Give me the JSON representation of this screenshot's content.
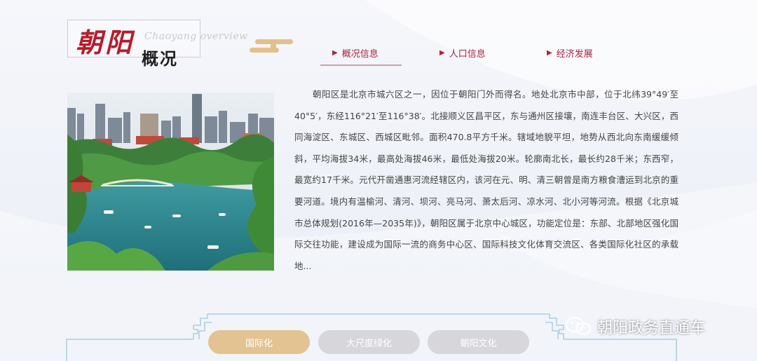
{
  "logo": {
    "title_cn": "朝阳",
    "subtitle_en": "Chaoyang overview",
    "title_cn_2": "概况"
  },
  "tabs": [
    {
      "label": "概况信息",
      "active": true
    },
    {
      "label": "人口信息",
      "active": false
    },
    {
      "label": "经济发展",
      "active": false
    }
  ],
  "content": {
    "image_alt": "朝阳区城市公园湖景",
    "paragraph": "朝阳区是北京市城六区之一，因位于朝阳门外而得名。地处北京市中部，位于北纬39°49′至40°5′，东经116°21′至116°38′。北接顺义区昌平区，东与通州区接壤，南连丰台区、大兴区，西同海淀区、东城区、西城区毗邻。面积470.8平方千米。辖域地貌平坦，地势从西北向东南缓缓倾斜，平均海拔34米，最高处海拔46米，最低处海拔20米。轮廓南北长，最长约28千米；东西窄，最宽约17千米。元代开凿通惠河流经辖区内，该河在元、明、清三朝曾是南方粮食漕运到北京的重要河道。境内有温榆河、清河、坝河、亮马河、萧太后河、凉水河、北小河等河流。根据《北京城市总体规划(2016年—2035年)》，朝阳区属于北京中心城区，功能定位是：东部、北部地区强化国际交往功能，建设成为国际一流的商务中心区、国际科技文化体育交流区、各类国际化社区的承载地..."
  },
  "bottom_tabs": [
    {
      "label": "国际化",
      "active": true
    },
    {
      "label": "大尺度绿化",
      "active": false
    },
    {
      "label": "朝阳文化",
      "active": false
    }
  ],
  "watermark": {
    "text": "朝阳政务直通车",
    "icon": "wechat-icon"
  },
  "colors": {
    "accent_red": "#b0223a",
    "gold": "#e2c391",
    "inactive_pill": "#d7d6da"
  }
}
